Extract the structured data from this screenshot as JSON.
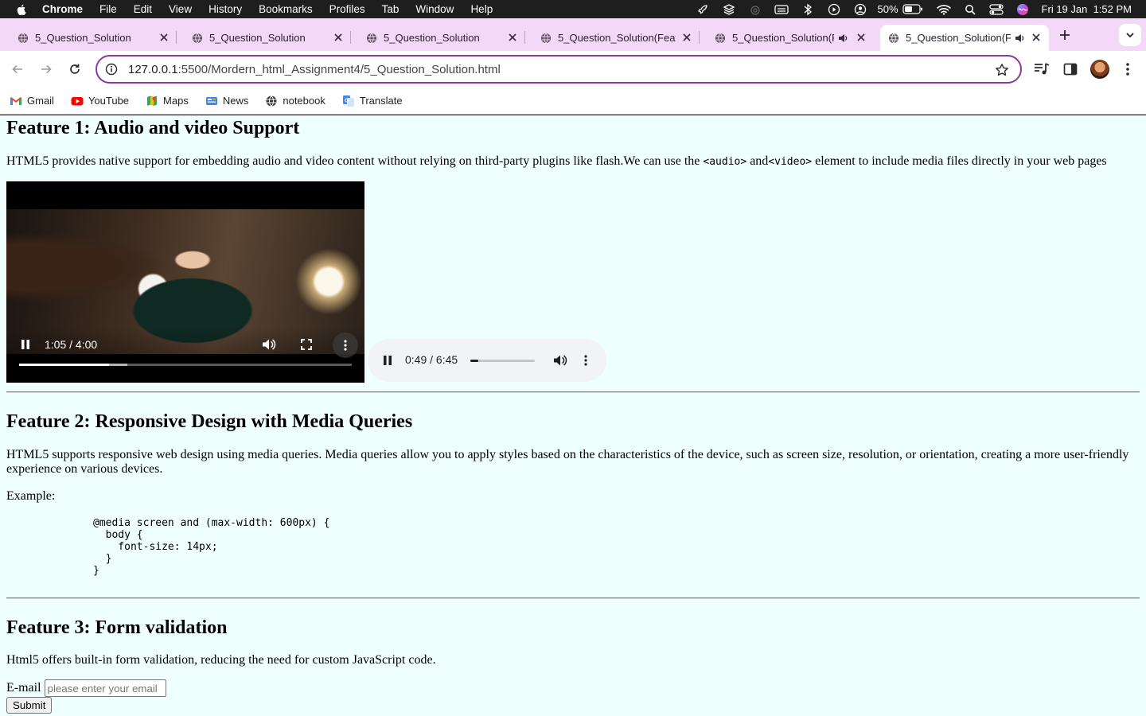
{
  "menubar": {
    "app": "Chrome",
    "items": [
      "File",
      "Edit",
      "View",
      "History",
      "Bookmarks",
      "Profiles",
      "Tab",
      "Window",
      "Help"
    ],
    "battery": "50%",
    "datetime": "Fri 19 Jan  1:52 PM",
    "status_icons": [
      "rocket-icon",
      "layers-icon",
      "airdrop-icon",
      "keyboard-icon",
      "bluetooth-icon",
      "play-icon",
      "user-icon",
      "battery-icon",
      "wifi-icon",
      "search-icon",
      "control-center-icon",
      "siri-icon"
    ]
  },
  "tabs": [
    {
      "title": "5_Question_Solution",
      "audio": false,
      "active": false
    },
    {
      "title": "5_Question_Solution",
      "audio": false,
      "active": false
    },
    {
      "title": "5_Question_Solution",
      "audio": false,
      "active": false
    },
    {
      "title": "5_Question_Solution(Feat",
      "audio": false,
      "active": false
    },
    {
      "title": "5_Question_Solution(F",
      "audio": true,
      "active": false
    },
    {
      "title": "5_Question_Solution(F",
      "audio": true,
      "active": true
    }
  ],
  "address": {
    "host": "127.0.0.1",
    "path": ":5500/Mordern_html_Assignment4/5_Question_Solution.html"
  },
  "bookmarks": [
    {
      "label": "Gmail",
      "icon": "gmail-icon"
    },
    {
      "label": "YouTube",
      "icon": "youtube-icon"
    },
    {
      "label": "Maps",
      "icon": "maps-icon"
    },
    {
      "label": "News",
      "icon": "news-icon"
    },
    {
      "label": "notebook",
      "icon": "globe-icon"
    },
    {
      "label": "Translate",
      "icon": "translate-icon"
    }
  ],
  "content": {
    "feature1": {
      "heading": "Feature 1: Audio and video Support",
      "text_before": "HTML5 provides native support for embedding audio and video content without relying on third-party plugins like flash.We can use the ",
      "code1": "<audio>",
      "text_mid": " and",
      "code2": "<video>",
      "text_after": " element to include media files directly in your web pages"
    },
    "video": {
      "time": "1:05 / 4:00",
      "progress": 0.271,
      "buffered": 0.325
    },
    "audio": {
      "time": "0:49 / 6:45",
      "progress": 0.121
    },
    "feature2": {
      "heading": "Feature 2: Responsive Design with Media Queries",
      "text": "HTML5 supports responsive web design using media queries. Media queries allow you to apply styles based on the characteristics of the device, such as screen size, resolution, or orientation, creating a more user-friendly experience on various devices.",
      "example_label": "Example:",
      "code": "@media screen and (max-width: 600px) {\n  body {\n    font-size: 14px;\n  }\n}"
    },
    "feature3": {
      "heading": "Feature 3: Form validation",
      "text": "Html5 offers built-in form validation, reducing the need for custom JavaScript code.",
      "email_label": "E-mail",
      "email_placeholder": "please enter your email",
      "submit_label": "Submit"
    }
  },
  "colors": {
    "page_bg": "#eefffe",
    "tabstrip_bg": "#f3d8f7",
    "omnibox_border": "#8a3a9c"
  }
}
